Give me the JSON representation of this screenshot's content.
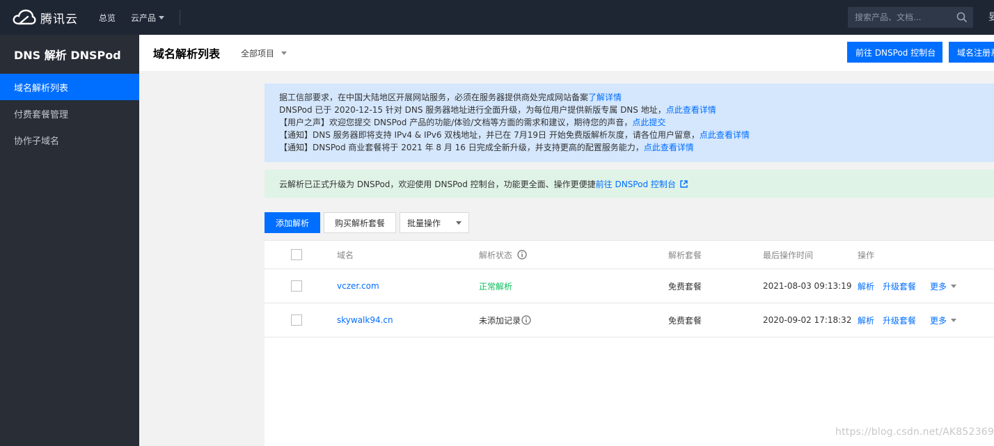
{
  "topbar": {
    "brand": "腾讯云",
    "nav": [
      {
        "label": "总览"
      },
      {
        "label": "云产品"
      }
    ],
    "search_placeholder": "搜索产品、文档...",
    "edge_glyph": "妟"
  },
  "sidebar": {
    "title": "DNS 解析 DNSPod",
    "items": [
      {
        "label": "域名解析列表",
        "active": true
      },
      {
        "label": "付费套餐管理",
        "active": false
      },
      {
        "label": "协作子域名",
        "active": false
      }
    ]
  },
  "header": {
    "title": "域名解析列表",
    "project_select": "全部项目",
    "button_console": "前往 DNSPod 控制台",
    "button_register": "域名注册系统"
  },
  "notice": {
    "line1_text": "据工信部要求，在中国大陆地区开展网站服务，必须在服务器提供商处完成网站备案",
    "line1_link": "了解详情",
    "line2_text": "DNSPod 已于 2020-12-15 针对 DNS 服务器地址进行全面升级，为每位用户提供新版专属 DNS 地址，",
    "line2_link": "点此查看详情",
    "line3_text": "【用户之声】欢迎您提交 DNSPod 产品的功能/体验/文档等方面的需求和建议，期待您的声音，",
    "line3_link": "点此提交",
    "line4_text": "【通知】DNS 服务器即将支持 IPv4 & IPv6 双栈地址，并已在 7月19日 开始免费版解析灰度，请各位用户留意，",
    "line4_link": "点此查看详情",
    "line5_text": "【通知】DNSPod 商业套餐将于 2021 年 8 月 16 日完成全新升级，并支持更高的配置服务能力，",
    "line5_link": "点此查看详情"
  },
  "tip": {
    "text": "云解析已正式升级为 DNSPod，欢迎使用 DNSPod 控制台，功能更全面、操作更便捷 ",
    "link": "前往 DNSPod 控制台"
  },
  "toolbar": {
    "add_label": "添加解析",
    "buy_label": "购买解析套餐",
    "batch_label": "批量操作"
  },
  "table": {
    "columns": {
      "domain": "域名",
      "status": "解析状态",
      "plan": "解析套餐",
      "time": "最后操作时间",
      "ops": "操作"
    },
    "rows": [
      {
        "domain": "vczer.com",
        "status": "正常解析",
        "plan": "免费套餐",
        "time": "2021-08-03 09:13:19",
        "op_resolve": "解析",
        "op_upgrade": "升级套餐",
        "op_more": "更多"
      },
      {
        "domain": "skywalk94.cn",
        "status": "未添加记录",
        "plan": "免费套餐",
        "time": "2020-09-02 17:18:32",
        "op_resolve": "解析",
        "op_upgrade": "升级套餐",
        "op_more": "更多"
      }
    ]
  },
  "watermark": "https://blog.csdn.net/AK852369",
  "colors": {
    "accent": "#006eff",
    "topbar": "#1f2633",
    "sidebar": "#292d36",
    "status_ok": "#0abf5b",
    "notice_bg": "#d5e7fd",
    "tip_bg": "#dff3e6"
  }
}
